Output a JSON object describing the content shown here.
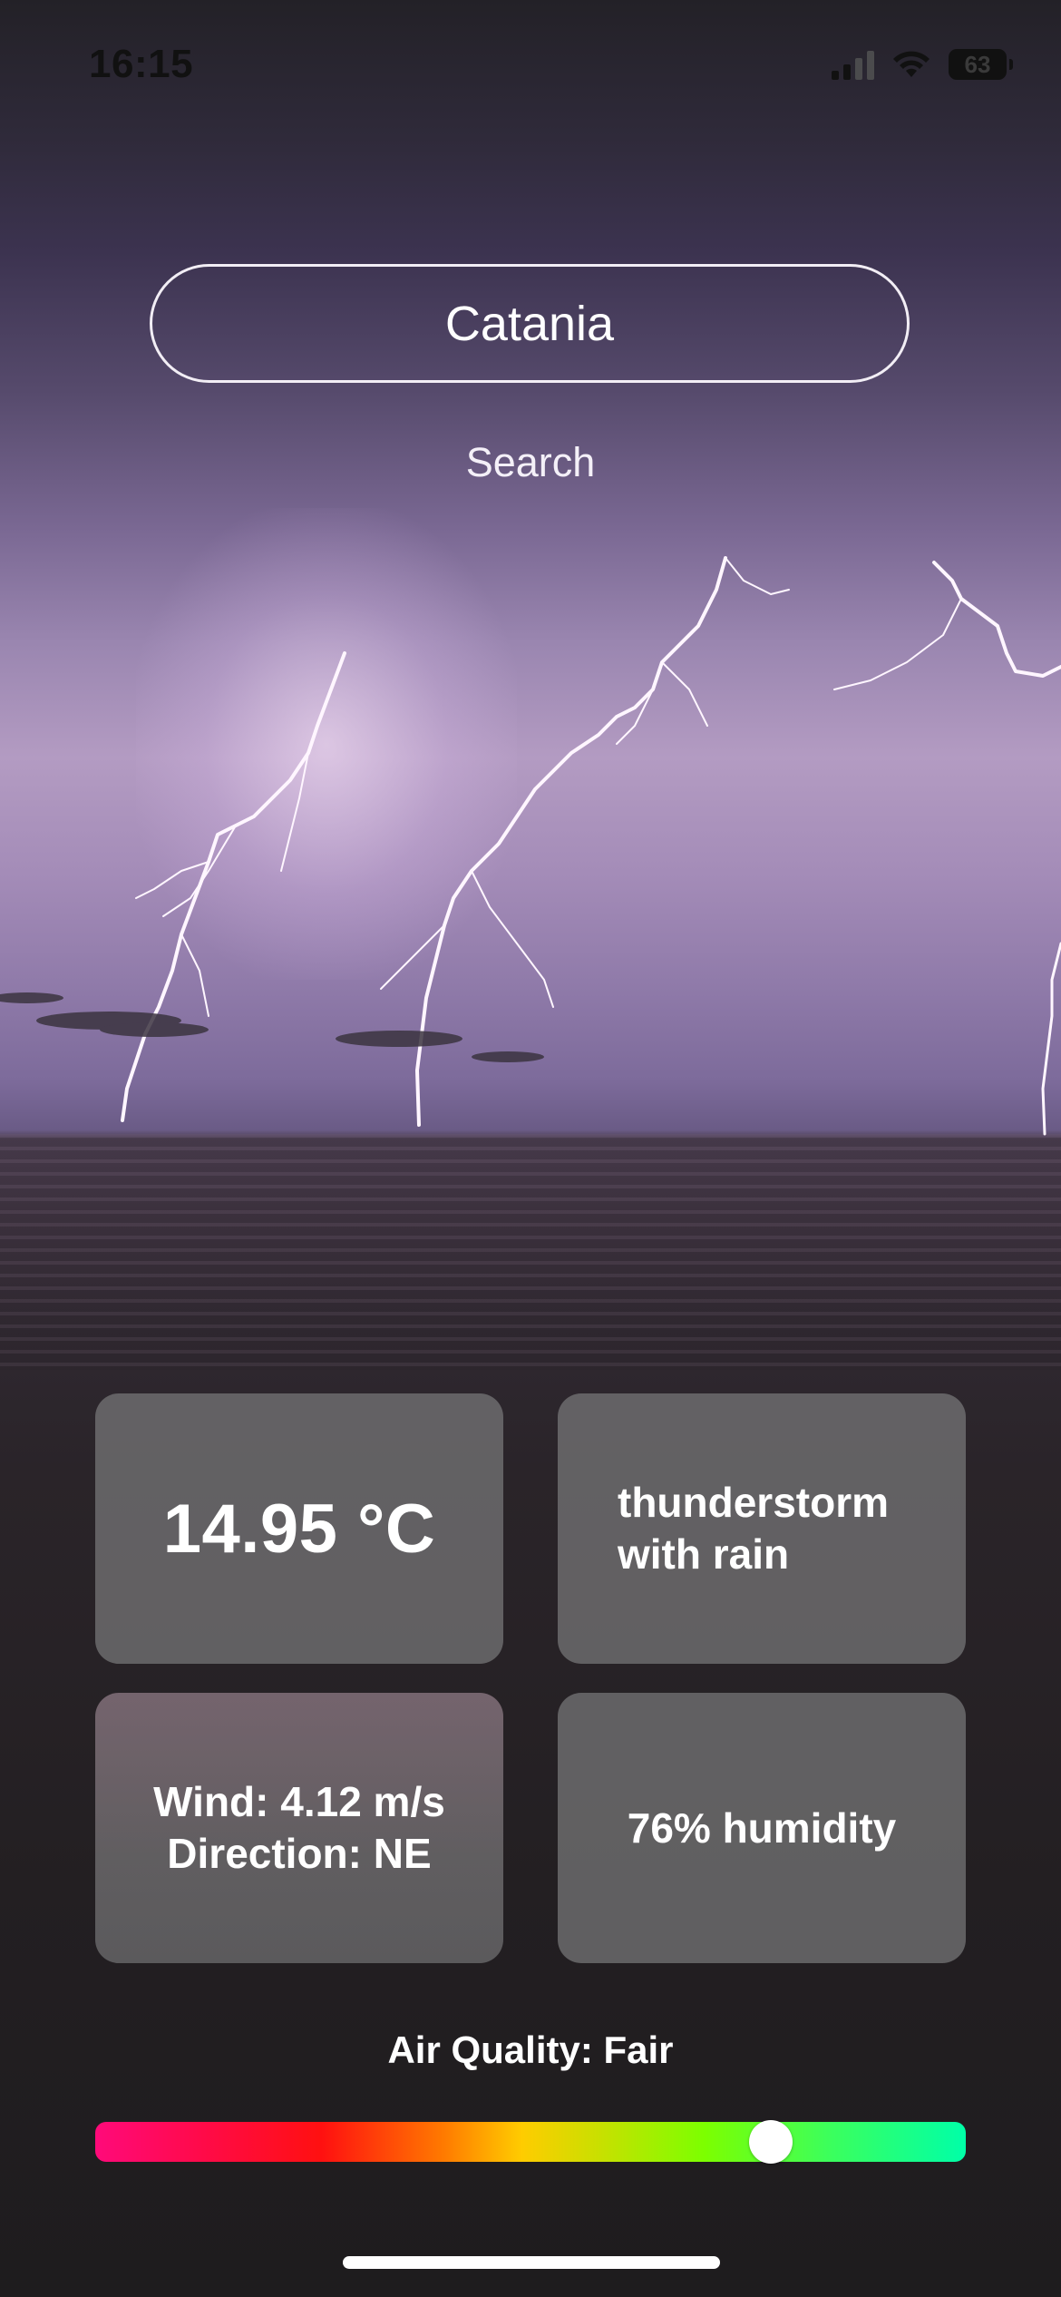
{
  "status_bar": {
    "time": "16:15",
    "battery": "63",
    "icons": [
      "cellular-signal-icon",
      "wifi-icon",
      "battery-icon"
    ]
  },
  "search": {
    "city_value": "Catania",
    "button_label": "Search"
  },
  "weather": {
    "temperature": "14.95 °C",
    "condition": "thunderstorm with rain",
    "wind_speed": "Wind: 4.12 m/s",
    "wind_direction": "Direction: NE",
    "humidity": "76% humidity"
  },
  "air_quality": {
    "label": "Air Quality: Fair",
    "level_fraction": 0.776,
    "scale_colors": [
      "#ff0a7a",
      "#ff1010",
      "#ff7a00",
      "#ffcc00",
      "#7cff00",
      "#00ffa8"
    ]
  },
  "colors": {
    "card_background": "#78787a",
    "text": "#ffffff"
  }
}
